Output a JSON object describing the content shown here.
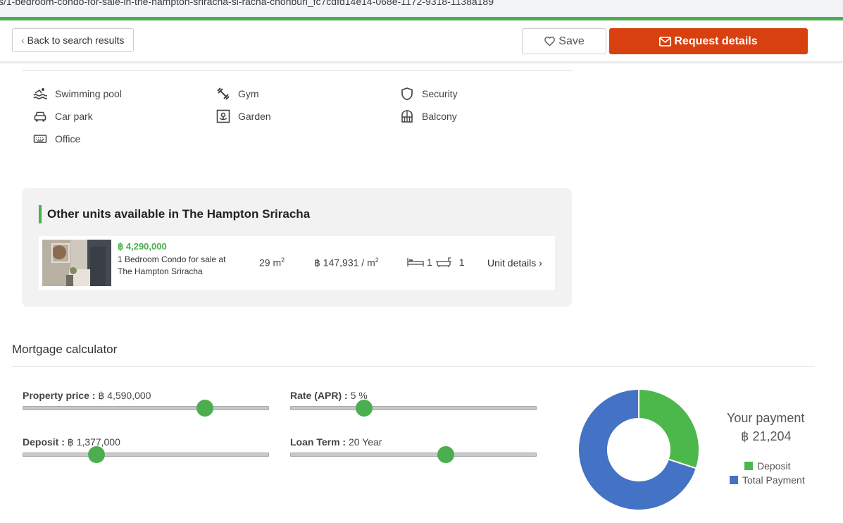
{
  "browser": {
    "url": "s/1-bedroom-condo-for-sale-in-the-hampton-sriracha-si-racha-chonburi_fc7cdfd14e14-068e-1172-9318-1138a189"
  },
  "header": {
    "back_label": "Back to search results",
    "save_label": "Save",
    "request_label": "Request details",
    "accent_color": "#4cae4f",
    "request_color": "#d9400f"
  },
  "amenities": [
    {
      "label": "Swimming pool",
      "icon": "swimming-pool-icon"
    },
    {
      "label": "Gym",
      "icon": "dumbbell-icon"
    },
    {
      "label": "Security",
      "icon": "shield-icon"
    },
    {
      "label": "Car park",
      "icon": "car-icon"
    },
    {
      "label": "Garden",
      "icon": "flower-icon"
    },
    {
      "label": "Balcony",
      "icon": "balcony-icon"
    },
    {
      "label": "Office",
      "icon": "keyboard-icon"
    }
  ],
  "other_units": {
    "title": "Other units available in The Hampton Sriracha",
    "unit": {
      "price": "฿ 4,290,000",
      "name": "1 Bedroom Condo for sale at The Hampton Sriracha",
      "size_value": "29 m",
      "size_sup": "2",
      "price_per_sqm": "฿ 147,931 / m",
      "price_per_sqm_sup": "2",
      "bedrooms": "1",
      "bathrooms": "1",
      "link_label": "Unit details"
    }
  },
  "mortgage": {
    "title": "Mortgage calculator",
    "property_price_label": "Property price :",
    "property_price_value": "฿ 4,590,000",
    "property_price_fraction": 0.74,
    "rate_label": "Rate (APR) :",
    "rate_value": "5 %",
    "rate_fraction": 0.3,
    "deposit_label": "Deposit :",
    "deposit_value": "฿ 1,377,000",
    "deposit_fraction": 0.3,
    "loan_term_label": "Loan Term :",
    "loan_term_value": "20 Year",
    "loan_term_fraction": 0.63,
    "payment_label": "Your payment",
    "payment_value": "฿ 21,204"
  },
  "chart_data": {
    "type": "pie",
    "categories": [
      "Deposit",
      "Total Payment"
    ],
    "values": [
      30,
      70
    ],
    "colors": [
      "#4cb74a",
      "#4472c4"
    ],
    "donut": true,
    "legend_position": "right"
  }
}
